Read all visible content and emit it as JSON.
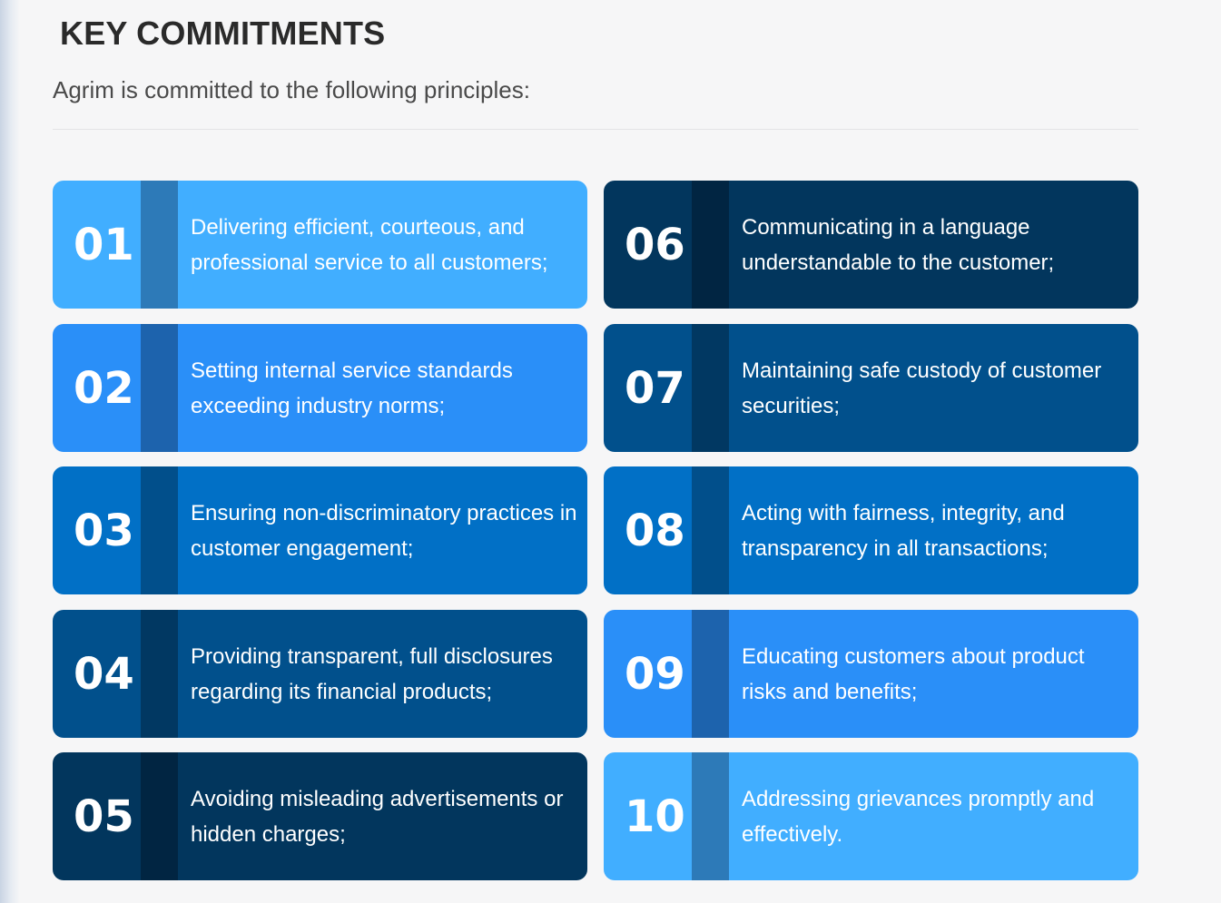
{
  "header": {
    "title": "KEY COMMITMENTS",
    "subtitle": "Agrim is committed to the following principles:"
  },
  "cards": [
    {
      "number": "01",
      "text": "Delivering efficient, courteous, and professional service to all customers;",
      "bg": "#41aeff",
      "bar": "#2d7ab8"
    },
    {
      "number": "02",
      "text": "Setting internal service standards exceeding industry norms;",
      "bg": "#2a8ff8",
      "bar": "#1d63ad"
    },
    {
      "number": "03",
      "text": "Ensuring non-discriminatory practices in customer engagement;",
      "bg": "#0170c6",
      "bar": "#014f8b"
    },
    {
      "number": "04",
      "text": "Providing transparent, full disclosures regarding its financial products;",
      "bg": "#01508c",
      "bar": "#013862"
    },
    {
      "number": "05",
      "text": "Avoiding misleading advertisements or hidden charges;",
      "bg": "#02365d",
      "bar": "#012542"
    },
    {
      "number": "06",
      "text": "Communicating in a language understandable to the customer;",
      "bg": "#02365d",
      "bar": "#012542"
    },
    {
      "number": "07",
      "text": "Maintaining safe custody of customer securities;",
      "bg": "#01508c",
      "bar": "#013862"
    },
    {
      "number": "08",
      "text": "Acting with fairness, integrity, and transparency in all transactions;",
      "bg": "#0170c6",
      "bar": "#014f8b"
    },
    {
      "number": "09",
      "text": "Educating customers about product risks and benefits;",
      "bg": "#2a8ff8",
      "bar": "#1d63ad"
    },
    {
      "number": "10",
      "text": "Addressing grievances promptly and effectively.",
      "bg": "#41aeff",
      "bar": "#2d7ab8"
    }
  ]
}
